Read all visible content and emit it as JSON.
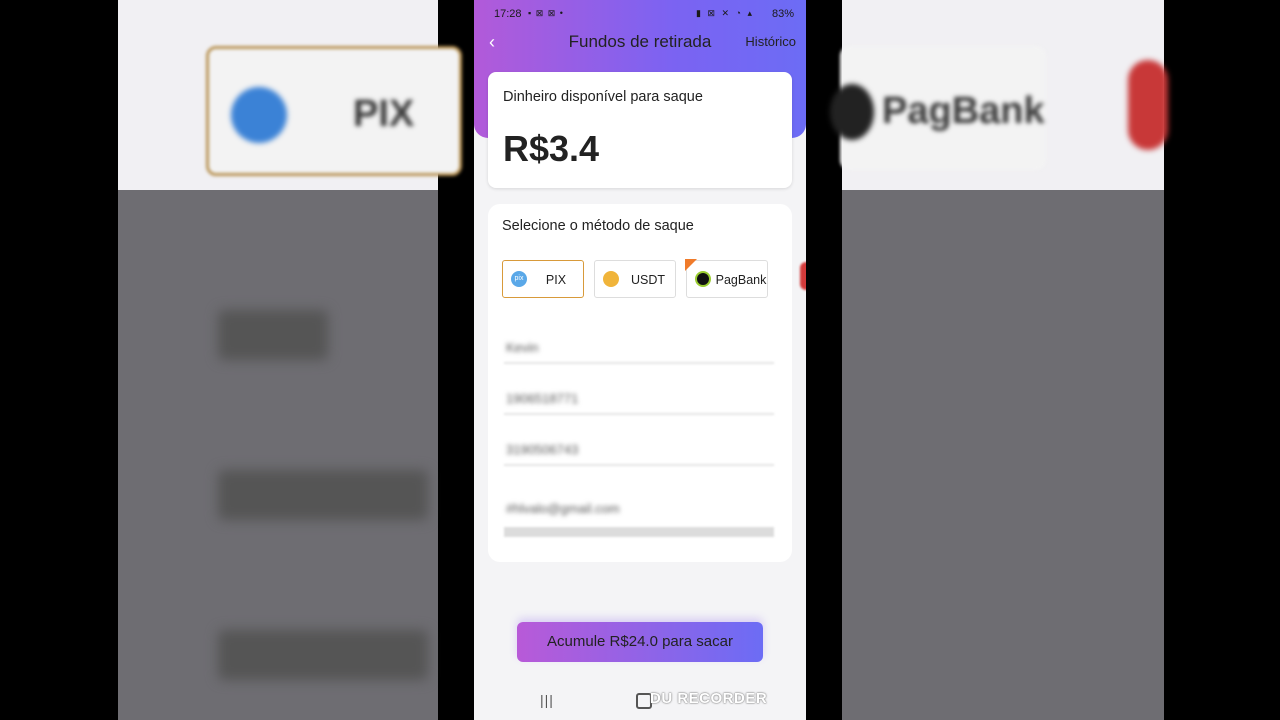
{
  "status_bar": {
    "time": "17:28",
    "battery": "83%",
    "icons_left": "▪ ⊠ ⊠ •",
    "icons_right": "▮ ⊠ ✕ ◔ ▴"
  },
  "header": {
    "back_icon": "chevron-left-icon",
    "title": "Fundos de retirada",
    "history_link": "Histórico"
  },
  "balance": {
    "label": "Dinheiro disponível para saque",
    "amount": "R$3.4"
  },
  "methods": {
    "label": "Selecione o método de saque",
    "options": [
      {
        "label": "PIX",
        "icon": "pix-icon",
        "icon_text": "pix",
        "selected": true
      },
      {
        "label": "USDT",
        "icon": "usdt-coin-icon",
        "selected": false
      },
      {
        "label": "PagBank",
        "icon": "pagbank-icon",
        "selected": false
      }
    ]
  },
  "form_fields": [
    "Kevin",
    "1906518771",
    "3190506743",
    "#hlvalo@gmail.com"
  ],
  "withdraw_button": "Acumule R$24.0 para sacar",
  "background_blur": {
    "pix_text": "PIX",
    "pagbank_text": "PagBank"
  },
  "watermark": "DU RECORDER",
  "colors": {
    "header_gradient_start": "#b25ad9",
    "header_gradient_end": "#6c6cf5",
    "selected_border": "#d89a3a"
  }
}
